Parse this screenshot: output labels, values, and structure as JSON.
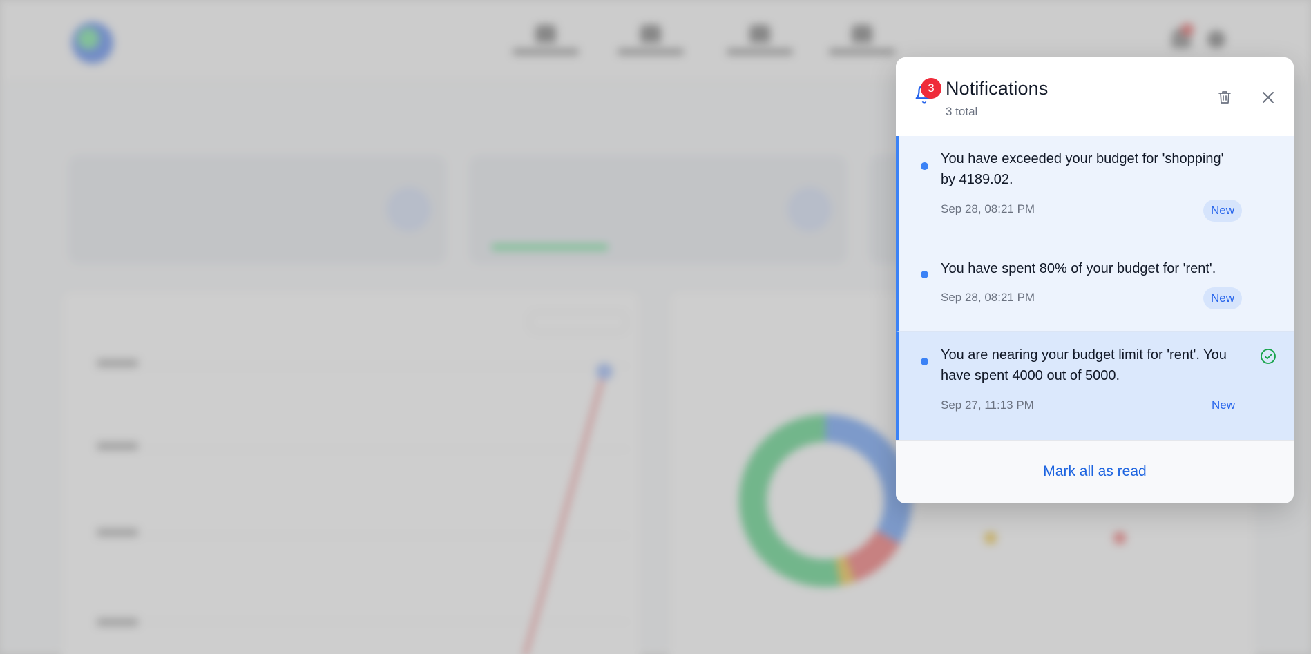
{
  "notifications_panel": {
    "title": "Notifications",
    "total_label": "3 total",
    "unread_count": "3",
    "icons": {
      "bell": "bell-icon",
      "delete": "trash-icon",
      "close": "close-icon",
      "read": "check-circle-icon"
    },
    "items": [
      {
        "message": "You have exceeded your budget for 'shopping' by 4189.02.",
        "time": "Sep 28, 08:21 PM",
        "status": "New"
      },
      {
        "message": "You have spent 80% of your budget for 'rent'.",
        "time": "Sep 28, 08:21 PM",
        "status": "New"
      },
      {
        "message": "You are nearing your budget limit for 'rent'. You have spent 4000 out of 5000.",
        "time": "Sep 27, 11:13 PM",
        "status": "New"
      }
    ],
    "footer_action": "Mark all as read"
  },
  "colors": {
    "accent": "#2563eb",
    "unread_dot": "#3b82f6",
    "badge_red": "#ef2b3a",
    "success": "#16a34a"
  }
}
